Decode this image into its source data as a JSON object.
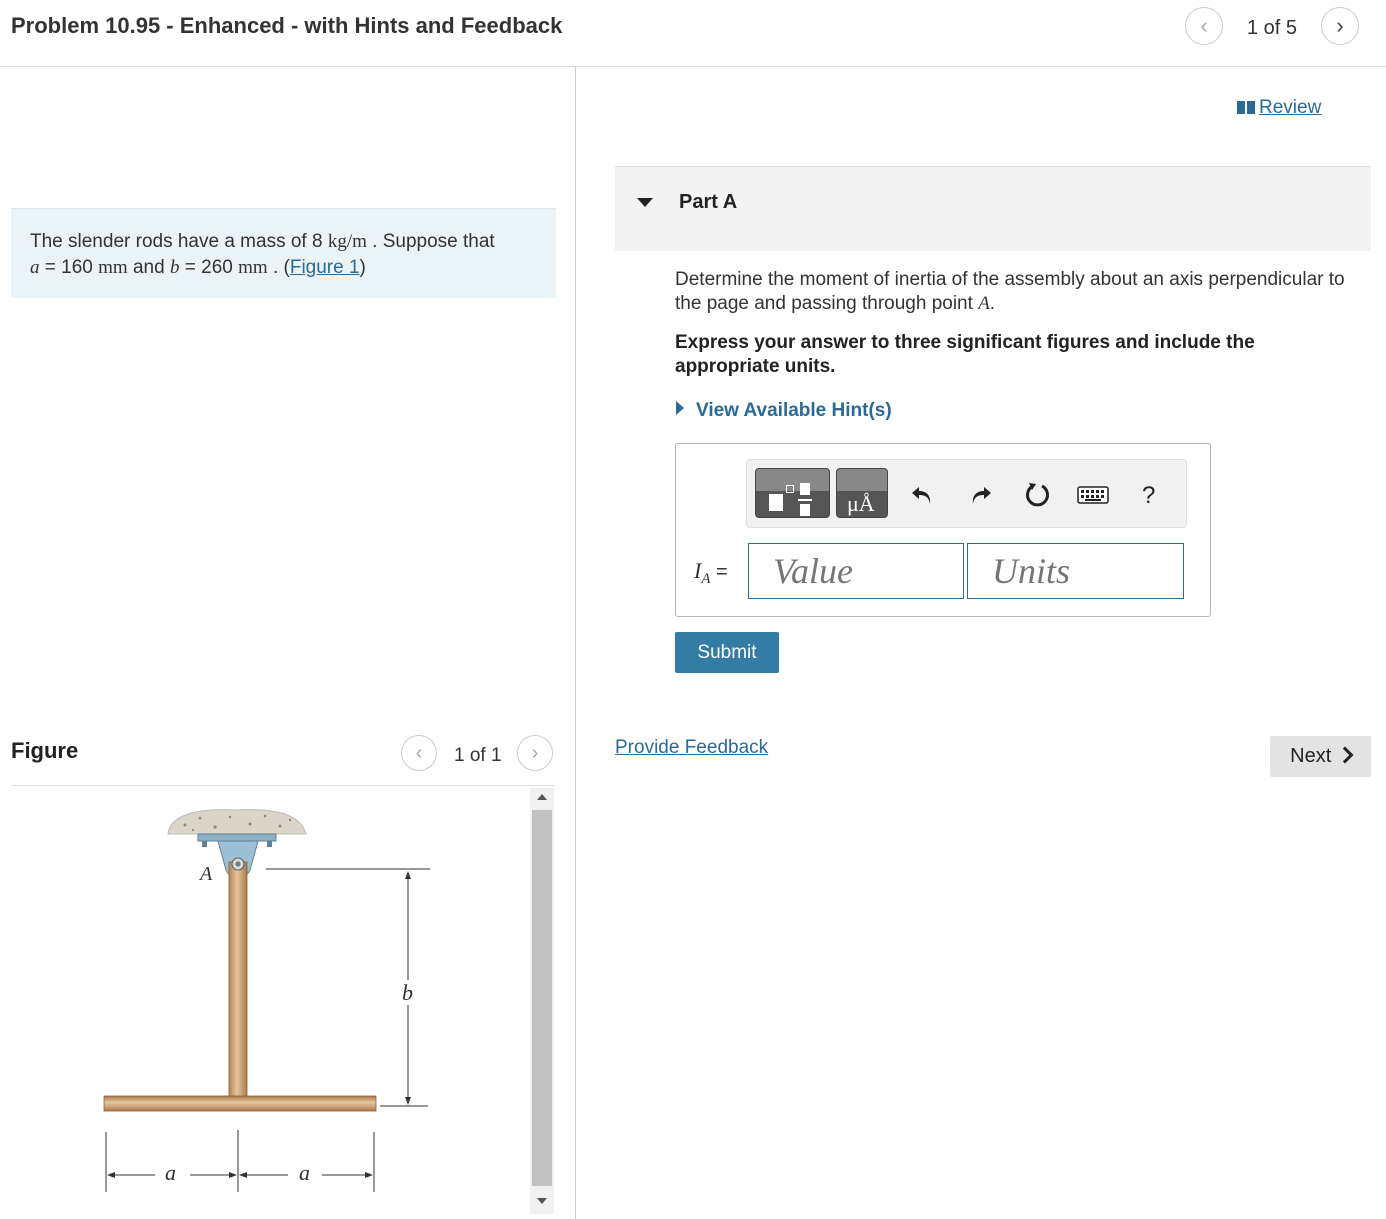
{
  "header": {
    "title": "Problem 10.95 - Enhanced - with Hints and Feedback",
    "pager": "1 of 5"
  },
  "problem": {
    "text_1": "The slender rods have a mass of 8 ",
    "unit_mass": "kg/m",
    "text_2": " . Suppose that",
    "var_a": "a",
    "eq_a": " = 160 ",
    "unit_a": "mm",
    "text_and": " and ",
    "var_b": "b",
    "eq_b": " = 260 ",
    "unit_b": "mm",
    "text_end": " . (",
    "figure_link": "Figure 1",
    "close_paren": ")"
  },
  "figure_panel": {
    "title": "Figure",
    "pager": "1 of 1",
    "labels": {
      "A": "A",
      "b": "b",
      "a1": "a",
      "a2": "a"
    }
  },
  "review": {
    "label": "Review"
  },
  "part": {
    "label": "Part A",
    "question_1": "Determine the moment of inertia of the assembly about an axis perpendicular to the page and passing through point ",
    "question_var": "A",
    "question_end": ".",
    "instruction": "Express your answer to three significant figures and include the appropriate units.",
    "hints_label": "View Available Hint(s)"
  },
  "answer": {
    "var": "I",
    "sub": "A",
    "eq": " =",
    "value_placeholder": "Value",
    "units_placeholder": "Units",
    "help": "?",
    "units_btn": "μÅ"
  },
  "actions": {
    "submit": "Submit",
    "feedback": "Provide Feedback",
    "next": "Next"
  },
  "colors": {
    "accent": "#2a6a96",
    "submit_bg": "#337ca3",
    "problem_bg": "#eaf3f6",
    "part_bg": "#f3f3f3",
    "input_border": "#2a6a96"
  }
}
